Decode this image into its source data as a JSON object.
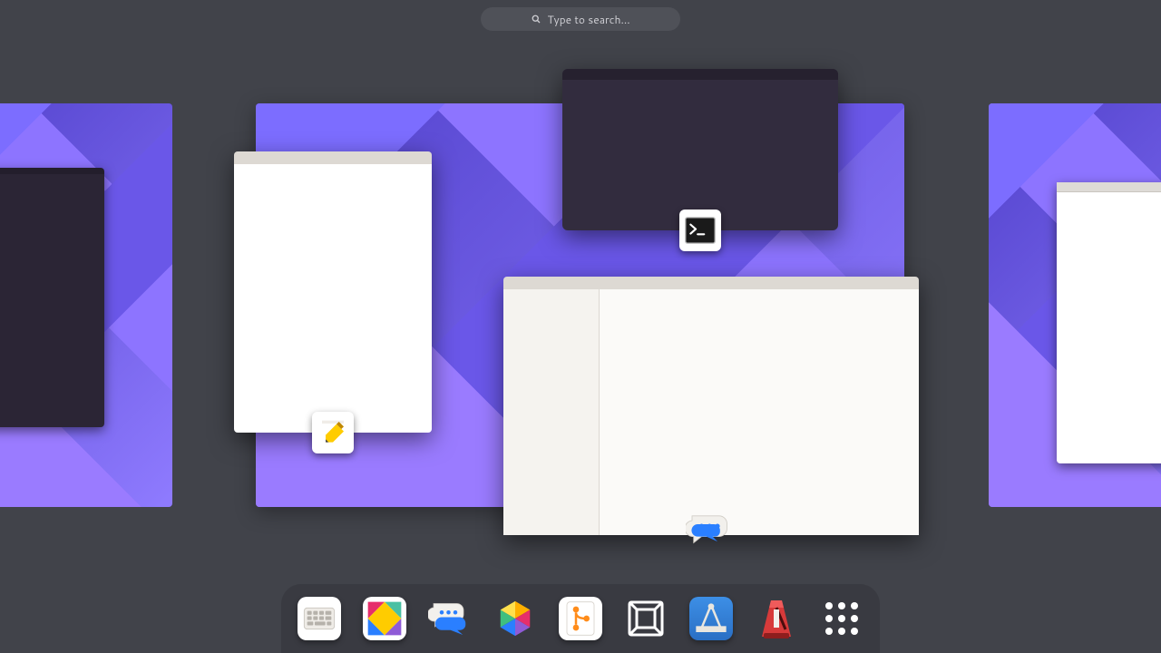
{
  "search": {
    "placeholder": "Type to search..."
  },
  "windows": {
    "editor": {
      "app_icon": "text-editor-icon"
    },
    "terminal": {
      "app_icon": "terminal-icon"
    },
    "chat": {
      "app_icon": "chat-icon"
    }
  },
  "dock": {
    "items": [
      {
        "icon": "keyboard-icon"
      },
      {
        "icon": "tangram-icon"
      },
      {
        "icon": "chat-icon"
      },
      {
        "icon": "color-manager-icon"
      },
      {
        "icon": "git-icon"
      },
      {
        "icon": "boxes-icon"
      },
      {
        "icon": "geometry-icon"
      },
      {
        "icon": "metronome-icon"
      },
      {
        "icon": "app-grid-icon"
      }
    ]
  }
}
